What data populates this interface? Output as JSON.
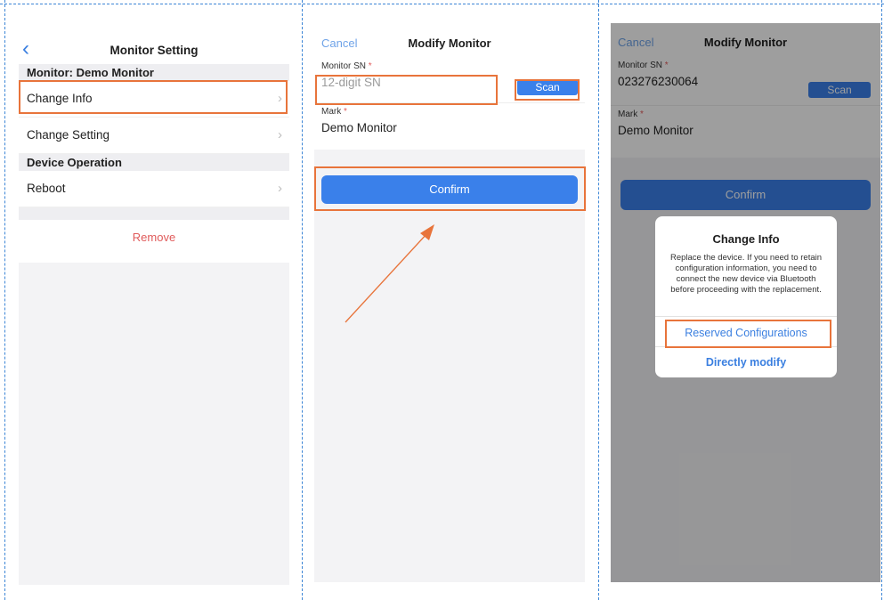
{
  "panel1": {
    "title": "Monitor Setting",
    "back_icon": "chevron-left-icon",
    "section_monitor": "Monitor: Demo Monitor",
    "rows": [
      {
        "label": "Change Info"
      },
      {
        "label": "Change Setting"
      }
    ],
    "section_device": "Device Operation",
    "reboot_label": "Reboot",
    "remove_label": "Remove",
    "chevron": "›"
  },
  "panel2": {
    "cancel_label": "Cancel",
    "title": "Modify Monitor",
    "sn_label": "Monitor SN",
    "required_mark": "*",
    "sn_placeholder": "12-digit SN",
    "scan_label": "Scan",
    "mark_label": "Mark",
    "mark_value": "Demo Monitor",
    "confirm_label": "Confirm"
  },
  "panel3": {
    "cancel_label": "Cancel",
    "title": "Modify Monitor",
    "sn_label": "Monitor SN",
    "required_mark": "*",
    "sn_value": "023276230064",
    "scan_label": "Scan",
    "mark_label": "Mark",
    "mark_value": "Demo Monitor",
    "confirm_label": "Confirm",
    "dialog": {
      "title": "Change Info",
      "message": "Replace the device. If you need to retain configuration information, you need to connect the new device via Bluetooth before proceeding with the replacement.",
      "reserved_label": "Reserved Configurations",
      "direct_label": "Directly modify"
    }
  },
  "colors": {
    "accent": "#3a80ea",
    "highlight": "#e8743b",
    "danger": "#e05b5b",
    "divider": "#3d86d6"
  }
}
